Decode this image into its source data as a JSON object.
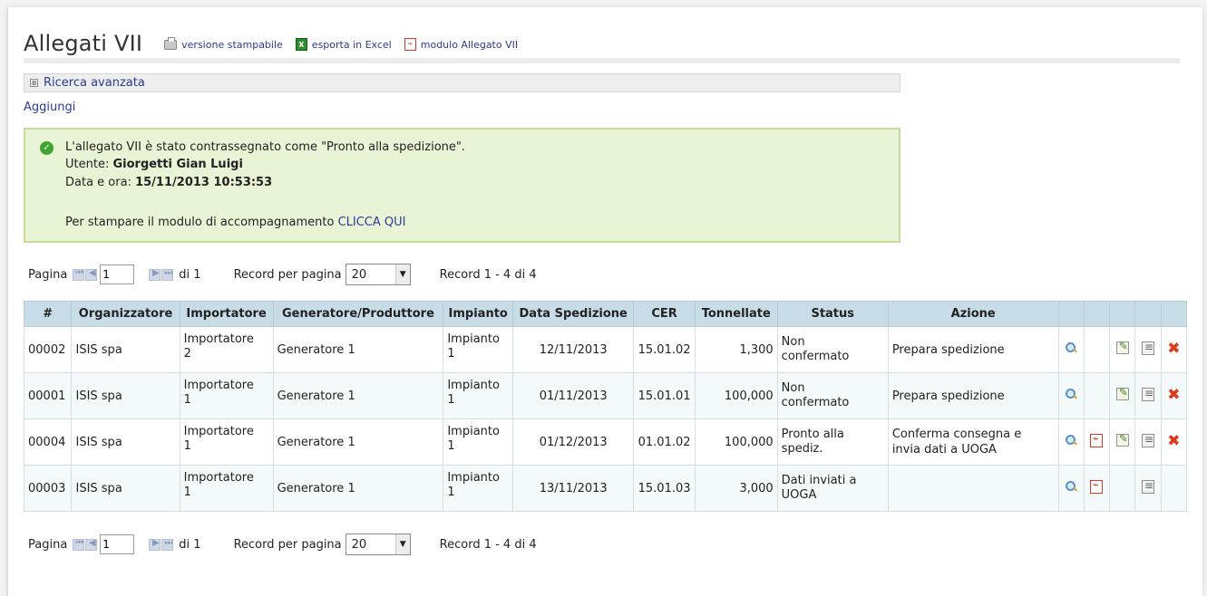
{
  "header": {
    "title": "Allegati VII",
    "links": {
      "print": "versione stampabile",
      "excel": "esporta in Excel",
      "module": "modulo Allegato VII"
    }
  },
  "search": {
    "toggle": "⊞",
    "label": "Ricerca avanzata"
  },
  "add_label": "Aggiungi",
  "message": {
    "line1": "L'allegato VII è stato contrassegnato come \"Pronto alla spedizione\".",
    "user_label": "Utente:",
    "user_value": "Giorgetti Gian Luigi",
    "date_label": "Data e ora:",
    "date_value": "15/11/2013 10:53:53",
    "print_text": "Per stampare il modulo di accompagnamento",
    "print_link": "CLICCA QUI",
    "icon": "check-icon"
  },
  "pager": {
    "label": "Pagina",
    "page_value": "1",
    "of_label": "di 1",
    "rpp_label": "Record per pagina",
    "rpp_value": "20",
    "records": "Record 1 - 4 di 4"
  },
  "table": {
    "headers": [
      "#",
      "Organizzatore",
      "Importatore",
      "Generatore/Produttore",
      "Impianto",
      "Data Spedizione",
      "CER",
      "Tonnellate",
      "Status",
      "Azione"
    ],
    "rows": [
      {
        "id": "00002",
        "org": "ISIS spa",
        "imp_a": "Importatore",
        "imp_b": "2",
        "gen": "Generatore 1",
        "pla_a": "Impianto",
        "pla_b": "1",
        "date": "12/11/2013",
        "cer": "15.01.02",
        "ton": "1,300",
        "status_a": "Non",
        "status_b": "confermato",
        "action_a": "Prepara spedizione",
        "action_b": ""
      },
      {
        "id": "00001",
        "org": "ISIS spa",
        "imp_a": "Importatore",
        "imp_b": "1",
        "gen": "Generatore 1",
        "pla_a": "Impianto",
        "pla_b": "1",
        "date": "01/11/2013",
        "cer": "15.01.01",
        "ton": "100,000",
        "status_a": "Non",
        "status_b": "confermato",
        "action_a": "Prepara spedizione",
        "action_b": ""
      },
      {
        "id": "00004",
        "org": "ISIS spa",
        "imp_a": "Importatore",
        "imp_b": "1",
        "gen": "Generatore 1",
        "pla_a": "Impianto",
        "pla_b": "1",
        "date": "01/12/2013",
        "cer": "01.01.02",
        "ton": "100,000",
        "status_a": "Pronto alla",
        "status_b": "spediz.",
        "action_a": "Conferma consegna e",
        "action_b": "invia dati a UOGA"
      },
      {
        "id": "00003",
        "org": "ISIS spa",
        "imp_a": "Importatore",
        "imp_b": "1",
        "gen": "Generatore 1",
        "pla_a": "Impianto",
        "pla_b": "1",
        "date": "13/11/2013",
        "cer": "15.01.03",
        "ton": "3,000",
        "status_a": "Dati inviati a",
        "status_b": "UOGA",
        "action_a": "",
        "action_b": ""
      }
    ]
  }
}
